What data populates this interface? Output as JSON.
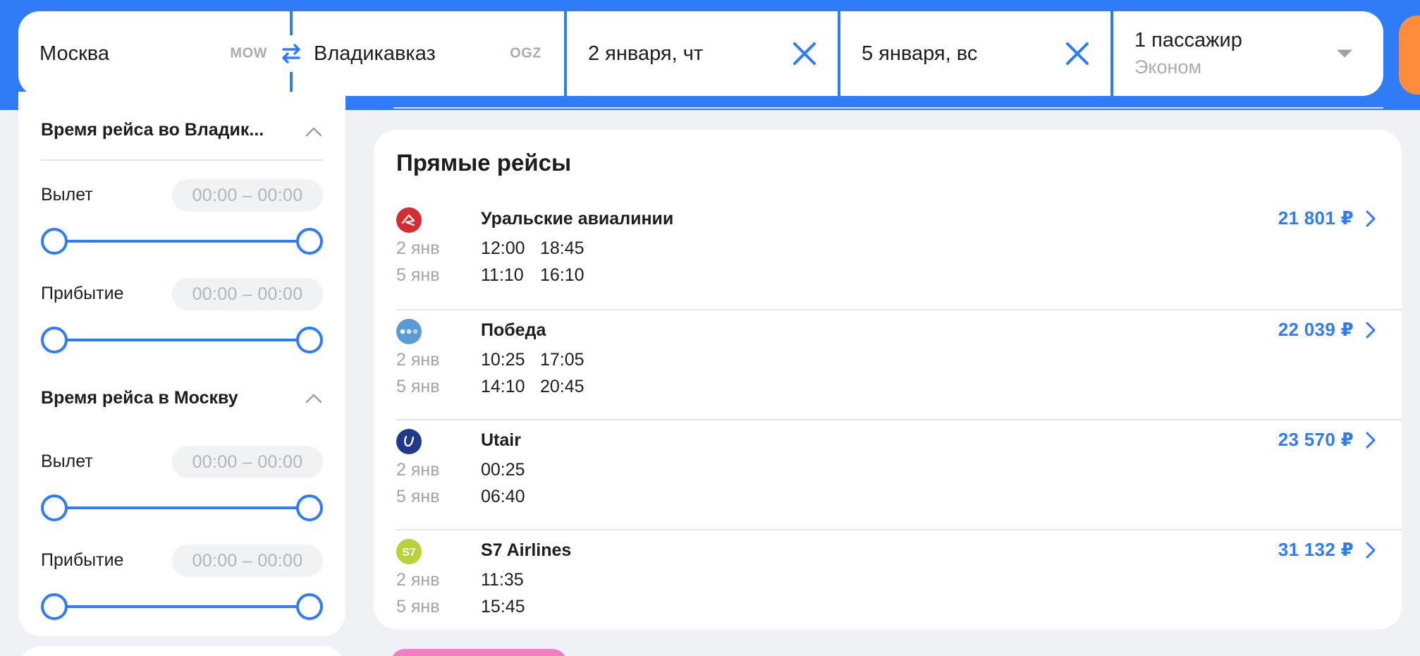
{
  "search": {
    "origin": {
      "city": "Москва",
      "iata": "MOW"
    },
    "destination": {
      "city": "Владикавказ",
      "iata": "OGZ"
    },
    "depart_date": "2 января, чт",
    "return_date": "5 января, вс",
    "passengers": "1 пассажир",
    "cabin_class": "Эконом"
  },
  "filters": {
    "groups": [
      {
        "title": "Время рейса во Владик...",
        "departure_label": "Вылет",
        "departure_range": "00:00 – 00:00",
        "arrival_label": "Прибытие",
        "arrival_range": "00:00 – 00:00"
      },
      {
        "title": "Время рейса в Москву",
        "departure_label": "Вылет",
        "departure_range": "00:00 – 00:00",
        "arrival_label": "Прибытие",
        "arrival_range": "00:00 – 00:00"
      }
    ]
  },
  "results": {
    "title": "Прямые рейсы",
    "flights": [
      {
        "airline": "Уральские авиалинии",
        "logo_color": "#d52b31",
        "price": "21 801 ₽",
        "legs": [
          {
            "date": "2 янв",
            "time1": "12:00",
            "time2": "18:45"
          },
          {
            "date": "5 янв",
            "time1": "11:10",
            "time2": "16:10"
          }
        ]
      },
      {
        "airline": "Победа",
        "logo_color": "#5b9bd5",
        "price": "22 039 ₽",
        "legs": [
          {
            "date": "2 янв",
            "time1": "10:25",
            "time2": "17:05"
          },
          {
            "date": "5 янв",
            "time1": "14:10",
            "time2": "20:45"
          }
        ]
      },
      {
        "airline": "Utair",
        "logo_color": "#1f3a86",
        "price": "23 570 ₽",
        "legs": [
          {
            "date": "2 янв",
            "time1": "00:25",
            "time2": ""
          },
          {
            "date": "5 янв",
            "time1": "06:40",
            "time2": ""
          }
        ]
      },
      {
        "airline": "S7 Airlines",
        "logo_color": "#b7d23a",
        "price": "31 132 ₽",
        "legs": [
          {
            "date": "2 янв",
            "time1": "11:35",
            "time2": ""
          },
          {
            "date": "5 янв",
            "time1": "15:45",
            "time2": ""
          }
        ]
      }
    ]
  },
  "colors": {
    "accent": "#2f7cf6",
    "cta": "#ff8c3b",
    "background": "#eff1f4"
  }
}
